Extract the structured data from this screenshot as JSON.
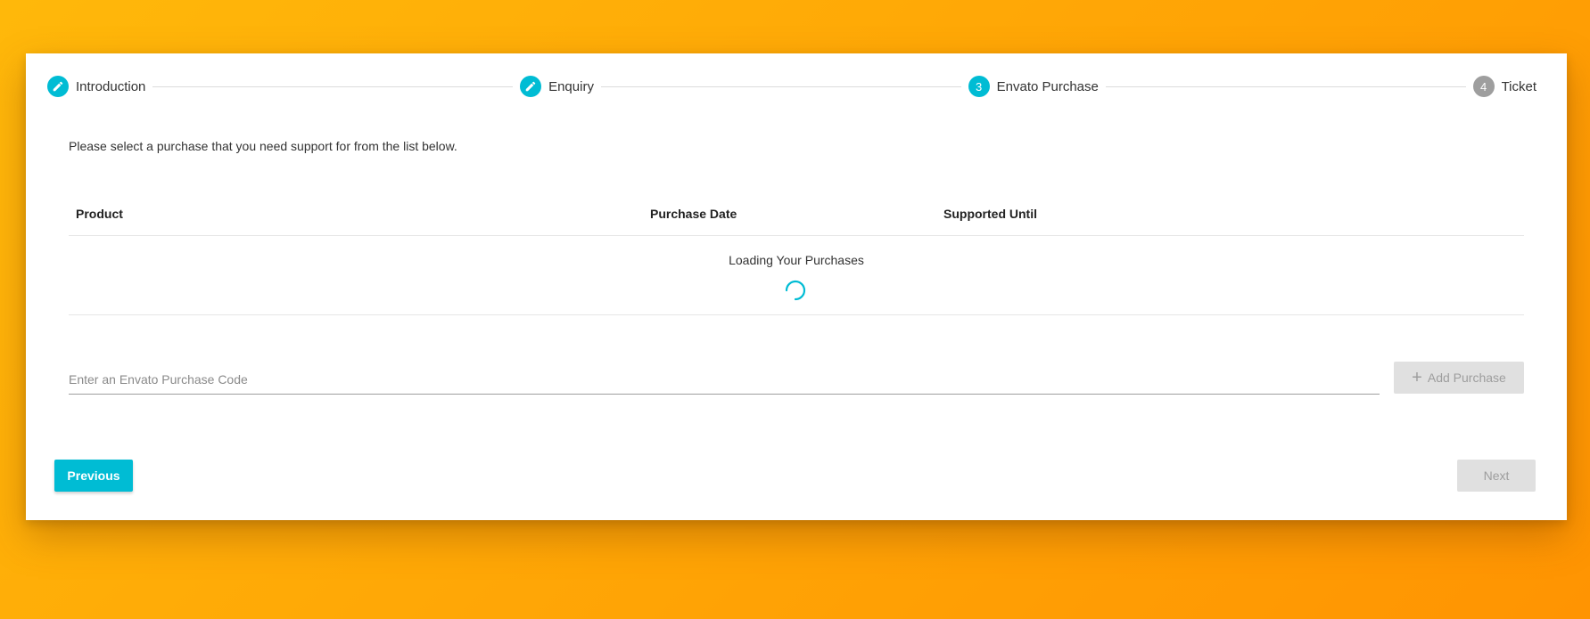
{
  "stepper": {
    "steps": [
      {
        "label": "Introduction",
        "number": "",
        "state": "completed",
        "icon": "edit-icon"
      },
      {
        "label": "Enquiry",
        "number": "",
        "state": "completed",
        "icon": "edit-icon"
      },
      {
        "label": "Envato Purchase",
        "number": "3",
        "state": "active"
      },
      {
        "label": "Ticket",
        "number": "4",
        "state": "pending"
      }
    ]
  },
  "intro_text": "Please select a purchase that you need support for from the list below.",
  "table": {
    "headers": {
      "product": "Product",
      "purchase_date": "Purchase Date",
      "supported_until": "Supported Until"
    },
    "loading_text": "Loading Your Purchases"
  },
  "purchase_code": {
    "placeholder": "Enter an Envato Purchase Code",
    "value": "",
    "add_button_label": "Add Purchase"
  },
  "nav": {
    "previous_label": "Previous",
    "next_label": "Next"
  },
  "colors": {
    "accent": "#00bcd4",
    "pending_step": "#9e9e9e",
    "disabled_bg": "#e0e0e0",
    "disabled_text": "#9e9e9e",
    "background_gradient_start": "#ffb80a",
    "background_gradient_end": "#ff9402"
  }
}
